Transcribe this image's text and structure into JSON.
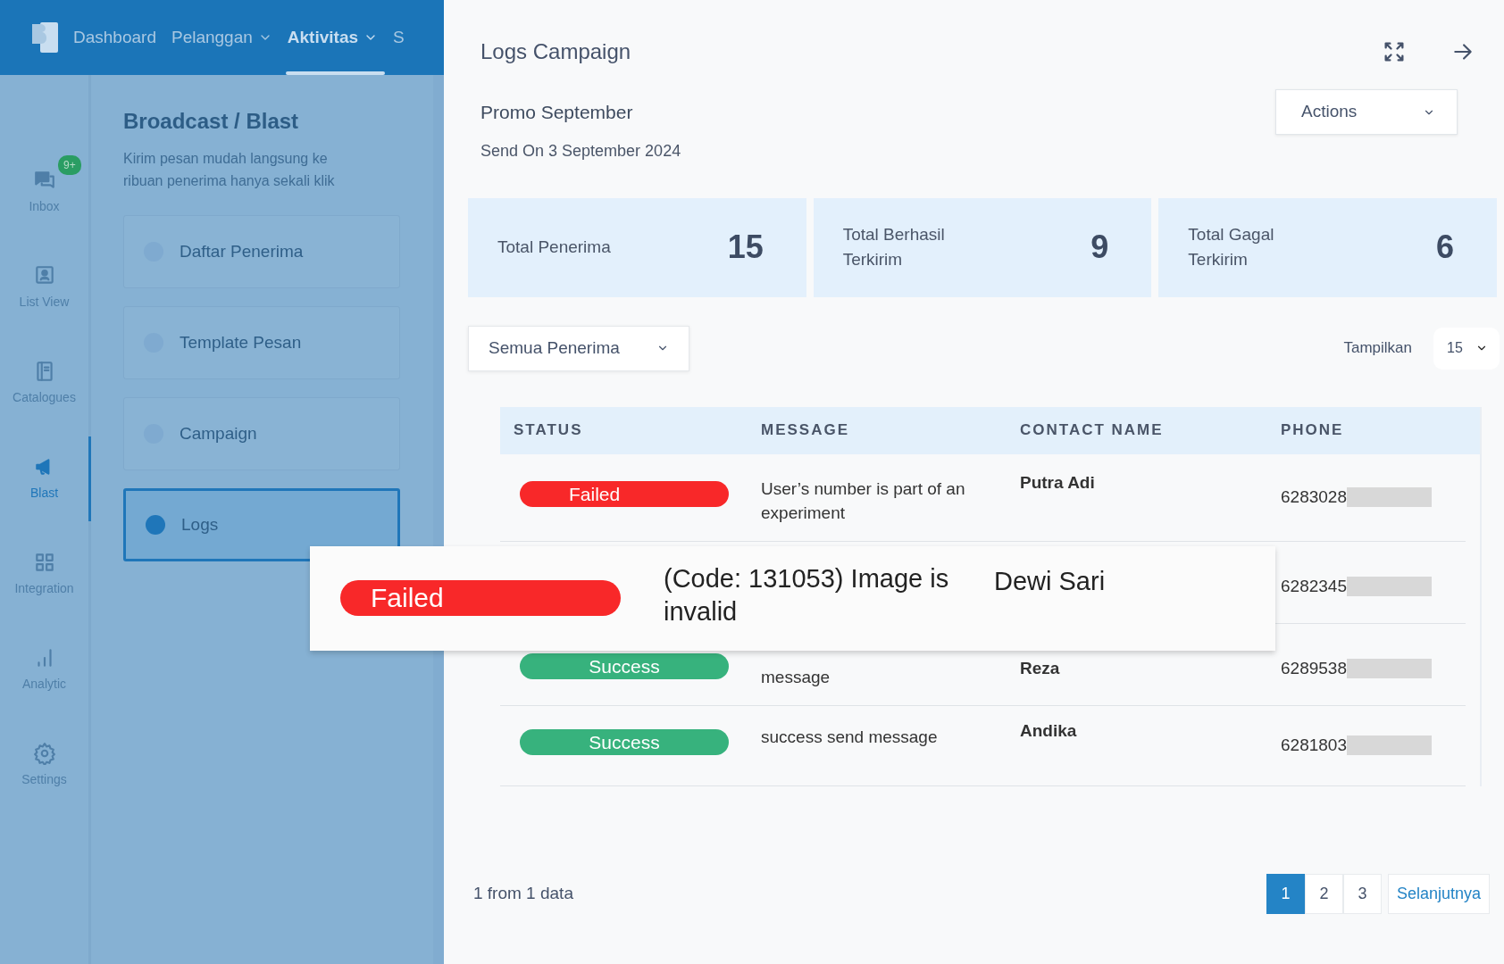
{
  "navbar": {
    "menu": [
      {
        "label": "Dashboard",
        "dropdown": false,
        "selected": false
      },
      {
        "label": "Pelanggan",
        "dropdown": true,
        "selected": false
      },
      {
        "label": "Aktivitas",
        "dropdown": true,
        "selected": true
      },
      {
        "label": "S",
        "dropdown": false,
        "selected": false
      }
    ]
  },
  "sidebar": {
    "items": [
      {
        "label": "Inbox",
        "kind": "chat",
        "badge": "9+",
        "selected": false
      },
      {
        "label": "List View",
        "kind": "contact",
        "selected": false
      },
      {
        "label": "Catalogues",
        "kind": "book",
        "selected": false
      },
      {
        "label": "Blast",
        "kind": "megaphone",
        "selected": true
      },
      {
        "label": "Integration",
        "kind": "grid",
        "selected": false
      },
      {
        "label": "Analytic",
        "kind": "bars",
        "selected": false
      },
      {
        "label": "Settings",
        "kind": "gear",
        "selected": false
      }
    ]
  },
  "section": {
    "title": "Broadcast / Blast",
    "description": "Kirim pesan mudah langsung ke ribuan penerima hanya sekali klik",
    "menu": [
      {
        "label": "Daftar Penerima",
        "selected": false
      },
      {
        "label": "Template Pesan",
        "selected": false
      },
      {
        "label": "Campaign",
        "selected": false
      },
      {
        "label": "Logs",
        "selected": true
      }
    ]
  },
  "panel": {
    "title": "Logs Campaign",
    "campaign_name": "Promo September",
    "sent_on": "Send On 3 September 2024",
    "actions": "Actions",
    "stats": [
      {
        "label": "Total Penerima",
        "value": "15"
      },
      {
        "label": "Total Berhasil Terkirim",
        "value": "9"
      },
      {
        "label": "Total Gagal Terkirim",
        "value": "6"
      }
    ],
    "filter": "Semua Penerima",
    "page_size_label": "Tampilkan",
    "page_size": "15",
    "table": {
      "columns": [
        "STATUS",
        "MESSAGE",
        "CONTACT NAME",
        "PHONE"
      ],
      "rows": [
        {
          "status": "Failed",
          "kind": "failed",
          "message": "User’s number is part of an experiment",
          "contact_name": "Putra Adi",
          "phone": "6283028"
        },
        {
          "phone": "6282345"
        },
        {
          "status": "Success",
          "kind": "success",
          "message": "message",
          "contact_name": "Reza",
          "phone": "6289538"
        },
        {
          "status": "Success",
          "kind": "success",
          "message": "success send message",
          "contact_name": "Andika",
          "phone": "6281803"
        }
      ]
    },
    "summary": "1 from 1 data",
    "pagination": {
      "pages": [
        {
          "label": "1",
          "selected": true
        },
        {
          "label": "2",
          "selected": false
        },
        {
          "label": "3",
          "selected": false
        }
      ],
      "next": "Selanjutnya"
    }
  },
  "callout": {
    "status": "Failed",
    "kind": "failed",
    "message": "(Code: 131053) Image is invalid",
    "contact_name": "Dewi Sari"
  }
}
